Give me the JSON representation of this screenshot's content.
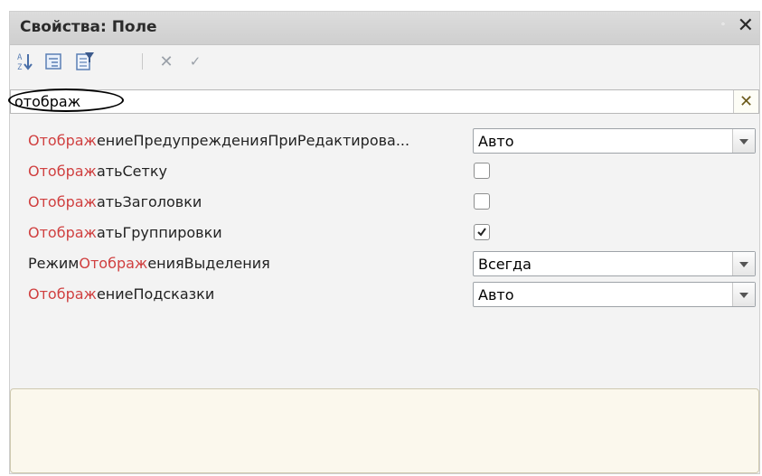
{
  "window": {
    "title": "Свойства: Поле",
    "pin_glyph": "ᵒ",
    "close_glyph": "✕"
  },
  "toolbar": {
    "buttons": [
      {
        "name": "sort-alphabet-icon"
      },
      {
        "name": "categories-icon"
      },
      {
        "name": "filter-icon"
      },
      {
        "name": "cancel-icon",
        "glyph": "✕"
      },
      {
        "name": "confirm-icon",
        "glyph": "✓"
      }
    ]
  },
  "search": {
    "value": "отображ",
    "clear_glyph": "✕"
  },
  "properties": [
    {
      "prefix": "",
      "highlight": "Отображ",
      "suffix": "ениеПредупрежденияПриРедактирова...",
      "control": "select",
      "value": "Авто"
    },
    {
      "prefix": "",
      "highlight": "Отображ",
      "suffix": "атьСетку",
      "control": "checkbox",
      "checked": false
    },
    {
      "prefix": "",
      "highlight": "Отображ",
      "suffix": "атьЗаголовки",
      "control": "checkbox",
      "checked": false
    },
    {
      "prefix": "",
      "highlight": "Отображ",
      "suffix": "атьГруппировки",
      "control": "checkbox",
      "checked": true
    },
    {
      "prefix": "Режим",
      "highlight": "Отображ",
      "suffix": "енияВыделения",
      "control": "select",
      "value": "Всегда"
    },
    {
      "prefix": "",
      "highlight": "Отображ",
      "suffix": "ениеПодсказки",
      "control": "select",
      "value": "Авто"
    }
  ],
  "colors": {
    "highlight": "#d04040",
    "description_bg": "#fbf8ed"
  }
}
